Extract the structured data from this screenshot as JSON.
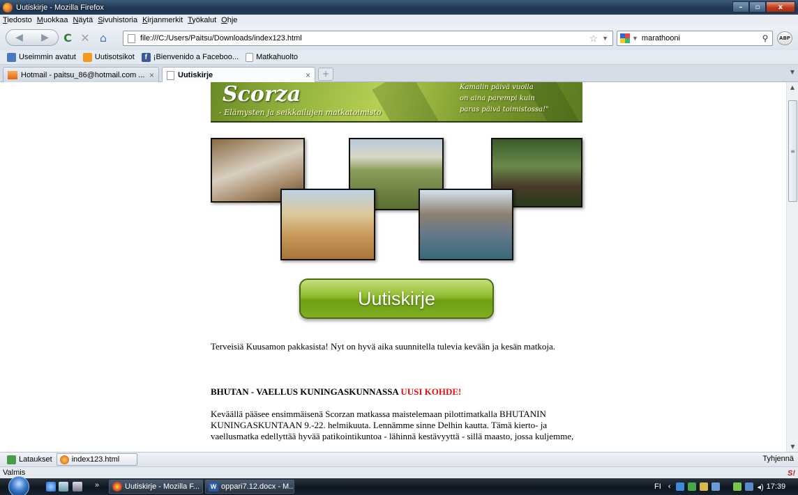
{
  "window": {
    "title": "Uutiskirje - Mozilla Firefox",
    "controls": {
      "minimize": "–",
      "maximize": "▫",
      "close": "x"
    }
  },
  "menu": [
    "Tiedosto",
    "Muokkaa",
    "Näytä",
    "Sivuhistoria",
    "Kirjanmerkit",
    "Työkalut",
    "Ohje"
  ],
  "nav": {
    "url": "file:///C:/Users/Paitsu/Downloads/index123.html",
    "search_query": "marathooni",
    "abp_label": "ABP"
  },
  "bookmarks": [
    {
      "label": "Useimmin avatut",
      "icon": "most-visited-icon"
    },
    {
      "label": "Uutisotsikot",
      "icon": "rss-icon"
    },
    {
      "label": "¡Bienvenido a Faceboo...",
      "icon": "facebook-icon"
    },
    {
      "label": "Matkahuolto",
      "icon": "page-icon"
    }
  ],
  "tabs": [
    {
      "label": "Hotmail - paitsu_86@hotmail.com ...",
      "active": false,
      "close": "×"
    },
    {
      "label": "Uutiskirje",
      "active": true,
      "close": "×"
    }
  ],
  "newtab_label": "+",
  "page": {
    "banner": {
      "brand": "Scorza",
      "tagline": "- Elämysten ja seikkailujen matkatoimisto",
      "quote_lines": [
        "Kamalin päivä vuolla",
        "on aina parempi kuin",
        "paras päivä toimistossa!\""
      ]
    },
    "button_label": "Uutiskirje",
    "intro": "Terveisiä Kuusamon pakkasista! Nyt on hyvä aika suunnitella tulevia kevään ja kesän matkoja.",
    "heading": "BHUTAN - VAELLUS KUNINGASKUNNASSA",
    "heading_badge": "UUSI KOHDE!",
    "body": "Keväällä pääsee ensimmäisenä Scorzan matkassa maistelemaan pilottimatkalla BHUTANIN KUNINGASKUNTAAN 9.-22. helmikuuta. Lennämme sinne Delhin kautta. Tämä kierto- ja vaellusmatka edellyttää hyvää patikointikuntoa - lähinnä kestävyyttä - sillä maasto, jossa kuljemme,"
  },
  "downloads": {
    "label": "Lataukset",
    "item": "index123.html",
    "clear": "Tyhjennä"
  },
  "status": "Valmis",
  "taskbar": {
    "more": "»",
    "tasks": [
      "Uutiskirje - Mozilla F...",
      "oppari7.12.docx - M..."
    ],
    "lang": "FI",
    "clock": "17:39"
  },
  "colors": {
    "accent_green": "#7fae22",
    "badge_red": "#e01010",
    "titlebar": "#1e3550"
  }
}
